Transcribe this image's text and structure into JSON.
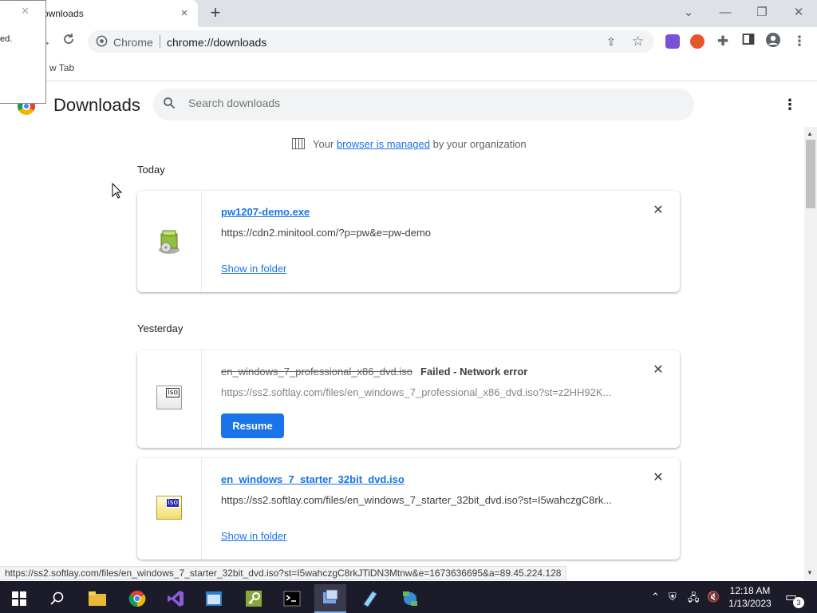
{
  "tabs": {
    "active_title": "ownloads",
    "close_glyph": "×",
    "new_tab_glyph": "+"
  },
  "window_controls": {
    "tab_search": "⌄",
    "minimize": "—",
    "restore": "❐",
    "close": "✕"
  },
  "popup": {
    "text": "ed."
  },
  "toolbar": {
    "site_label": "Chrome",
    "url": "chrome://downloads"
  },
  "bookmarks": {
    "label": "w Tab"
  },
  "header": {
    "title": "Downloads",
    "search_placeholder": "Search downloads"
  },
  "managed": {
    "prefix": "Your",
    "link": "browser is managed",
    "suffix": "by your organization"
  },
  "sections": {
    "today": "Today",
    "yesterday": "Yesterday"
  },
  "downloads": [
    {
      "name": "pw1207-demo.exe",
      "url": "https://cdn2.minitool.com/?p=pw&e=pw-demo",
      "action": "Show in folder"
    },
    {
      "name": "en_windows_7_professional_x86_dvd.iso",
      "status": "Failed - Network error",
      "url": "https://ss2.softlay.com/files/en_windows_7_professional_x86_dvd.iso?st=z2HH92K...",
      "action": "Resume",
      "icon_label": "iso"
    },
    {
      "name": "en_windows_7_starter_32bit_dvd.iso",
      "url": "https://ss2.softlay.com/files/en_windows_7_starter_32bit_dvd.iso?st=I5wahczgC8rk...",
      "action": "Show in folder",
      "icon_label": "iso"
    }
  ],
  "status_bubble": "https://ss2.softlay.com/files/en_windows_7_starter_32bit_dvd.iso?st=I5wahczgC8rkJTiDN3Mtnw&e=1673636695&a=89.45.224.128",
  "taskbar": {
    "time": "12:18 AM",
    "date": "1/13/2023",
    "notification_count": "3"
  },
  "colors": {
    "accent": "#1a73e8",
    "taskbar": "#1b1b2a"
  }
}
